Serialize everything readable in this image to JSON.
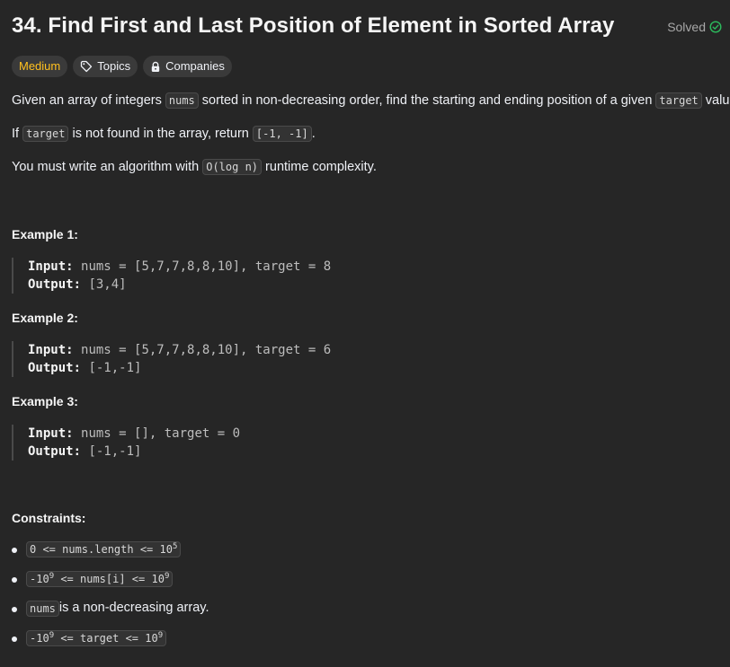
{
  "problem": {
    "title": "34. Find First and Last Position of Element in Sorted Array",
    "status": "Solved"
  },
  "tags": {
    "difficulty": "Medium",
    "topics": "Topics",
    "companies": "Companies"
  },
  "description": {
    "p1_a": "Given an array of integers ",
    "p1_code1": "nums",
    "p1_b": " sorted in non-decreasing order, find the starting and ending position of a given ",
    "p1_code2": "target",
    "p1_c": " value.",
    "p2_a": "If ",
    "p2_code1": "target",
    "p2_b": " is not found in the array, return ",
    "p2_code2": "[-1, -1]",
    "p2_c": ".",
    "p3_a": "You must write an algorithm with ",
    "p3_code": "O(log n)",
    "p3_b": " runtime complexity."
  },
  "examples": [
    {
      "title": "Example 1:",
      "input_label": "Input:",
      "input_value": "nums = [5,7,7,8,8,10], target = 8",
      "output_label": "Output:",
      "output_value": "[3,4]"
    },
    {
      "title": "Example 2:",
      "input_label": "Input:",
      "input_value": "nums = [5,7,7,8,8,10], target = 6",
      "output_label": "Output:",
      "output_value": "[-1,-1]"
    },
    {
      "title": "Example 3:",
      "input_label": "Input:",
      "input_value": "nums = [], target = 0",
      "output_label": "Output:",
      "output_value": "[-1,-1]"
    }
  ],
  "constraints": {
    "title": "Constraints:",
    "c1_code": "0 <= nums.length <= 10",
    "c1_sup": "5",
    "c2_code_a": "-10",
    "c2_sup_a": "9",
    "c2_code_b": " <= nums[i] <= 10",
    "c2_sup_b": "9",
    "c3_code": "nums",
    "c3_text": " is a non-decreasing array.",
    "c4_code_a": "-10",
    "c4_sup_a": "9",
    "c4_code_b": " <= target <= 10",
    "c4_sup_b": "9"
  },
  "colors": {
    "background": "#262626",
    "medium": "#ffc01e",
    "solved_check": "#2cbb5d",
    "tag_bg": "#3a3a3a"
  },
  "icons": {
    "solved": "check-circle-icon",
    "topics": "tag-icon",
    "companies": "lock-icon"
  }
}
